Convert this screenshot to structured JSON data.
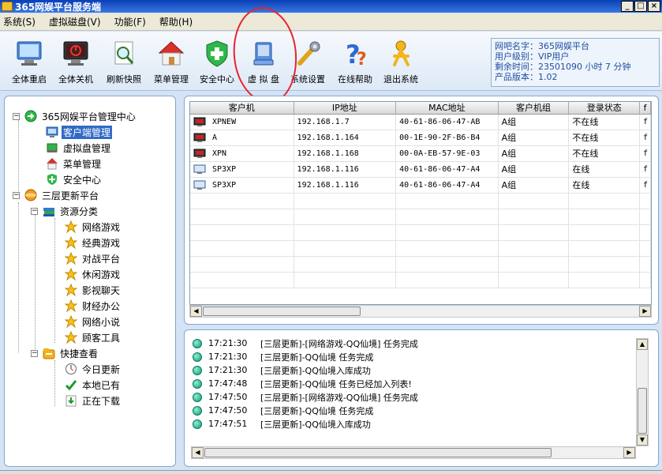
{
  "window": {
    "title": "365网娱平台服务端",
    "min_label": "_",
    "max_label": "□",
    "close_label": "×"
  },
  "menu": [
    "系统(S)",
    "虚拟磁盘(V)",
    "功能(F)",
    "帮助(H)"
  ],
  "toolbar": [
    {
      "label": "全体重启",
      "icon": "monitor-restart-icon"
    },
    {
      "label": "全体关机",
      "icon": "monitor-shutdown-icon"
    },
    {
      "label": "刷新快照",
      "icon": "magnifier-document-icon"
    },
    {
      "label": "菜单管理",
      "icon": "home-icon"
    },
    {
      "label": "安全中心",
      "icon": "shield-plus-icon"
    },
    {
      "label": "虚 拟 盘",
      "icon": "disk-drive-icon"
    },
    {
      "label": "系统设置",
      "icon": "wrench-icon"
    },
    {
      "label": "在线帮助",
      "icon": "question-icon"
    },
    {
      "label": "退出系统",
      "icon": "person-exit-icon"
    }
  ],
  "info": {
    "cafe_name": "网吧名字：365网娱平台",
    "user_level": "用户级别：VIP用户",
    "remaining": "剩余时间：23501090 小时 7 分钟",
    "version": "产品版本：1.02"
  },
  "tree": {
    "root1": "365网娱平台管理中心",
    "client_mgmt": "客户端管理",
    "vdisk_mgmt": "虚拟盘管理",
    "menu_mgmt": "菜单管理",
    "security": "安全中心",
    "root2": "三层更新平台",
    "resources": "资源分类",
    "categories": [
      "网络游戏",
      "经典游戏",
      "对战平台",
      "休闲游戏",
      "影视聊天",
      "财经办公",
      "网络小说",
      "顾客工具"
    ],
    "quick": "快捷查看",
    "today": "今日更新",
    "local": "本地已有",
    "downloading": "正在下载"
  },
  "table": {
    "headers": [
      "客户机",
      "IP地址",
      "MAC地址",
      "客户机组",
      "登录状态",
      "f"
    ],
    "rows": [
      {
        "name": "XPNEW",
        "ip": "192.168.1.7",
        "mac": "40-61-86-06-47-AB",
        "group": "A组",
        "status": "不在线",
        "online": false
      },
      {
        "name": "A",
        "ip": "192.168.1.164",
        "mac": "00-1E-90-2F-B6-B4",
        "group": "A组",
        "status": "不在线",
        "online": false
      },
      {
        "name": "XPN",
        "ip": "192.168.1.168",
        "mac": "00-0A-EB-57-9E-03",
        "group": "A组",
        "status": "不在线",
        "online": false
      },
      {
        "name": "SP3XP",
        "ip": "192.168.1.116",
        "mac": "40-61-86-06-47-A4",
        "group": "A组",
        "status": "在线",
        "online": true
      },
      {
        "name": "SP3XP",
        "ip": "192.168.1.116",
        "mac": "40-61-86-06-47-A4",
        "group": "A组",
        "status": "在线",
        "online": true
      }
    ]
  },
  "log": [
    {
      "time": "17:21:30",
      "msg": "[三层更新]-[网络游戏-QQ仙境] 任务完成"
    },
    {
      "time": "17:21:30",
      "msg": "[三层更新]-QQ仙境 任务完成"
    },
    {
      "time": "17:21:30",
      "msg": "[三层更新]-QQ仙境入库成功"
    },
    {
      "time": "17:47:48",
      "msg": "[三层更新]-QQ仙境 任务已经加入列表!"
    },
    {
      "time": "17:47:50",
      "msg": "[三层更新]-[网络游戏-QQ仙境] 任务完成"
    },
    {
      "time": "17:47:50",
      "msg": "[三层更新]-QQ仙境 任务完成"
    },
    {
      "time": "17:47:51",
      "msg": "[三层更新]-QQ仙境入库成功"
    }
  ]
}
